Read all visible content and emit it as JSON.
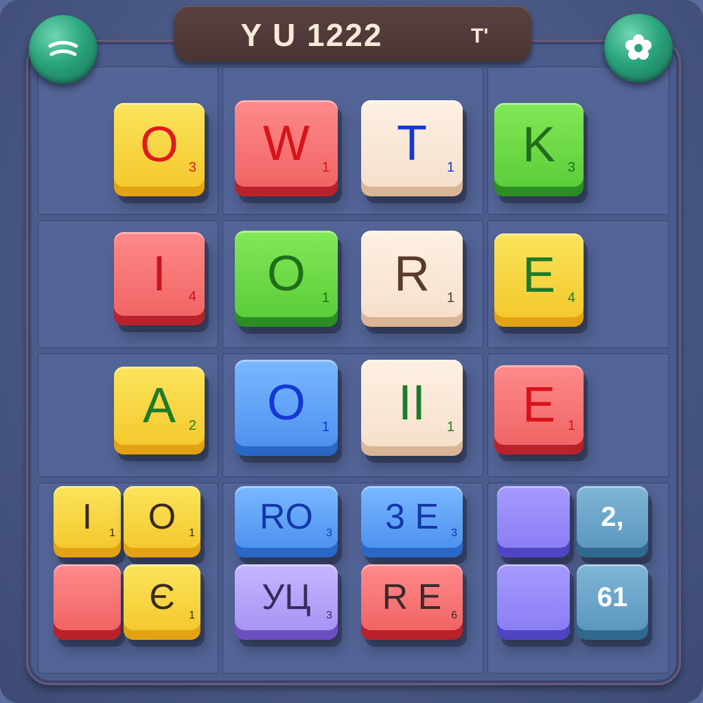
{
  "header": {
    "title": "Y U 1222",
    "side_label": "T'"
  },
  "buttons": {
    "left_icon": "menu-wave-icon",
    "right_icon": "flower-settings-icon"
  },
  "colors": {
    "board": "#4b5b8c",
    "title_bar": "#4a3434",
    "button": "#2aa47c"
  },
  "tiles": [
    {
      "letter": "O",
      "points": "3",
      "color": "yellow",
      "text_color": "#e0191f"
    },
    {
      "letter": "W",
      "points": "1",
      "color": "red",
      "text_color": "#d8121b"
    },
    {
      "letter": "T",
      "points": "1",
      "color": "cream",
      "text_color": "#1437d6"
    },
    {
      "letter": "K",
      "points": "3",
      "color": "green",
      "text_color": "#1f6e1a"
    },
    {
      "letter": "I",
      "points": "4",
      "color": "red",
      "text_color": "#c8121a"
    },
    {
      "letter": "O",
      "points": "1",
      "color": "green",
      "text_color": "#1f6e1a"
    },
    {
      "letter": "R",
      "points": "1",
      "color": "cream",
      "text_color": "#5a3a2c"
    },
    {
      "letter": "E",
      "points": "4",
      "color": "yellow",
      "text_color": "#1d7a2a"
    },
    {
      "letter": "A",
      "points": "2",
      "color": "yellow",
      "text_color": "#1d7a2a"
    },
    {
      "letter": "O",
      "points": "1",
      "color": "blue",
      "text_color": "#1437d6"
    },
    {
      "letter": "II",
      "points": "1",
      "color": "cream",
      "text_color": "#1d7a2a"
    },
    {
      "letter": "E",
      "points": "1",
      "color": "red",
      "text_color": "#d8121b"
    },
    {
      "letter": "I",
      "points": "1",
      "color": "yellow",
      "text_color": "#3a2a1c"
    },
    {
      "letter": "O",
      "points": "1",
      "color": "yellow",
      "text_color": "#3a2a1c"
    },
    {
      "letter": "RO",
      "points": "3",
      "color": "blue",
      "text_color": "#1437a8"
    },
    {
      "letter": "3 E",
      "points": "3",
      "color": "blue",
      "text_color": "#1437a8"
    },
    {
      "letter": "",
      "points": "",
      "color": "purple",
      "text_color": "#ffffff"
    },
    {
      "letter": "2,",
      "points": "",
      "color": "teal",
      "text_color": "#ffffff"
    },
    {
      "letter": "",
      "points": "",
      "color": "red",
      "text_color": "#ffffff"
    },
    {
      "letter": "Є",
      "points": "1",
      "color": "yellow",
      "text_color": "#3a2a1c"
    },
    {
      "letter": "УЦ",
      "points": "3",
      "color": "lilac",
      "text_color": "#3a2a5c"
    },
    {
      "letter": "R E",
      "points": "6",
      "color": "red",
      "text_color": "#3a2a2c"
    },
    {
      "letter": "",
      "points": "",
      "color": "purple",
      "text_color": "#ffffff"
    },
    {
      "letter": "61",
      "points": "",
      "color": "teal",
      "text_color": "#ffffff"
    }
  ]
}
